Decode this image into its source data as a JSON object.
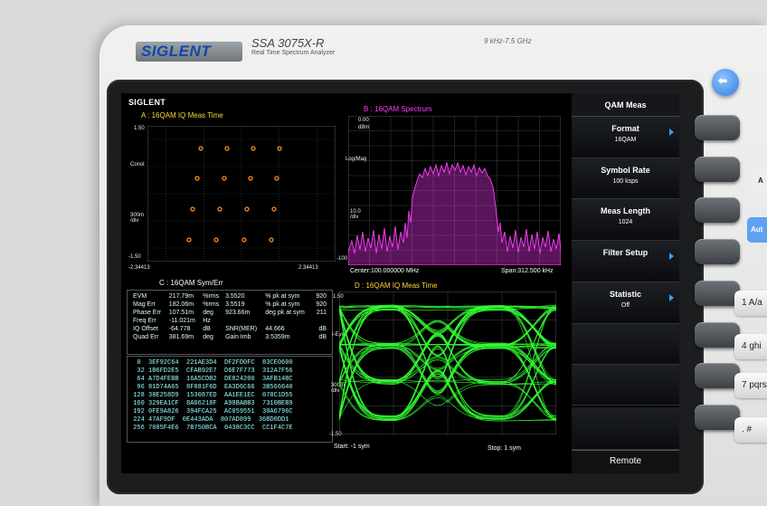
{
  "brand": {
    "name": "SIGLENT",
    "model": "SSA 3075X-R",
    "subtitle": "Real Time Spectrum Analyzer",
    "freq_range": "9 kHz-7.5 GHz"
  },
  "screen": {
    "logo": "SIGLENT",
    "trace_a": {
      "title": "A : 16QAM  IQ Meas Time",
      "y_top": "1.50",
      "y_bottom": "-1.50",
      "y_label": "Const",
      "y_div": "300m\n/div",
      "x_left": "-2.34413",
      "x_right": "2.34413"
    },
    "trace_b": {
      "title": "B : 16QAM  Spectrum",
      "ref": "0.00",
      "ref_unit": "dBm",
      "scale": "Log/Mag",
      "div": "10.0\n/div",
      "bottom": "-100",
      "center": "Center:100.000000 MHz",
      "span": "Span:312.500 kHz"
    },
    "trace_c": {
      "title": "C : 16QAM  Sym/Err",
      "rows": [
        [
          "EVM",
          "217.79m",
          "%rms",
          "3.5520",
          "% pk at sym",
          "920"
        ],
        [
          "Mag Err",
          "182.06m",
          "%rms",
          "3.5519",
          "% pk at sym",
          "920"
        ],
        [
          "Phase Err",
          "107.51m",
          "deg",
          "923.66m",
          "deg pk at sym",
          "211"
        ],
        [
          "Freq Err",
          "-11.021m",
          "Hz",
          "",
          "",
          ""
        ],
        [
          "IQ Offset",
          "-64.778",
          "dB",
          "SNR(MER)",
          "44.666",
          "dB"
        ],
        [
          "Quad Err",
          "381.69m",
          "deg",
          "Gain Imb",
          "3.5359m",
          "dB"
        ]
      ],
      "symbols": [
        "  0  3EF92C64  221AE3D4  DF2FD0FC  83CE0600",
        "  32 1B6FD2E5  CFAB92E7  D6E7F773  312A7F56",
        "  64 A7D4FEBB  16A5CDB2  DE824200  3AFB14BC",
        "  96 81D74A65  8F881F6D  EA3D6C66  3B566640",
        " 128 38E258D9  153087ED  AA1EE1EC  078C1D55",
        " 160 329EA1CF  8A06218F  A98BABB3  7310BEB9",
        " 192 0FE9A826  394FCA25  AC059551  30A6796C",
        " 224 47AF9DF  0E443ADA  807AD899  36BD0DD1",
        " 256 7085F4E6  7B750BCA  0438C3CC  CC1F4C7E"
      ]
    },
    "trace_d": {
      "title": "D : 16QAM  IQ Meas Time",
      "y_top": "1.50",
      "y_label": "I-Eye",
      "y_div": "300m\n/div",
      "y_bottom": "-1.50",
      "start": "Start: -1 sym",
      "stop": "Stop: 1 sym"
    },
    "menu": {
      "title": "QAM Meas",
      "items": [
        {
          "label": "Format",
          "value": "16QAM",
          "arrow": true
        },
        {
          "label": "Symbol Rate",
          "value": "100 ksps",
          "arrow": false
        },
        {
          "label": "Meas Length",
          "value": "1024",
          "arrow": false
        },
        {
          "label": "Filter Setup",
          "value": "",
          "arrow": true
        },
        {
          "label": "Statistic",
          "value": "Off",
          "arrow": true
        }
      ],
      "status": "Remote"
    }
  },
  "keypad": [
    "1 A/a",
    "4 ghi",
    "7 pqrs",
    ". #"
  ],
  "side_labels": [
    "A",
    "Aut"
  ],
  "colors": {
    "accent_yellow": "#ffd83a",
    "spectrum": "#ff3dff",
    "eye": "#33ff33",
    "menu_arrow": "#3a9cff",
    "constellation": "#ff8a1a"
  }
}
